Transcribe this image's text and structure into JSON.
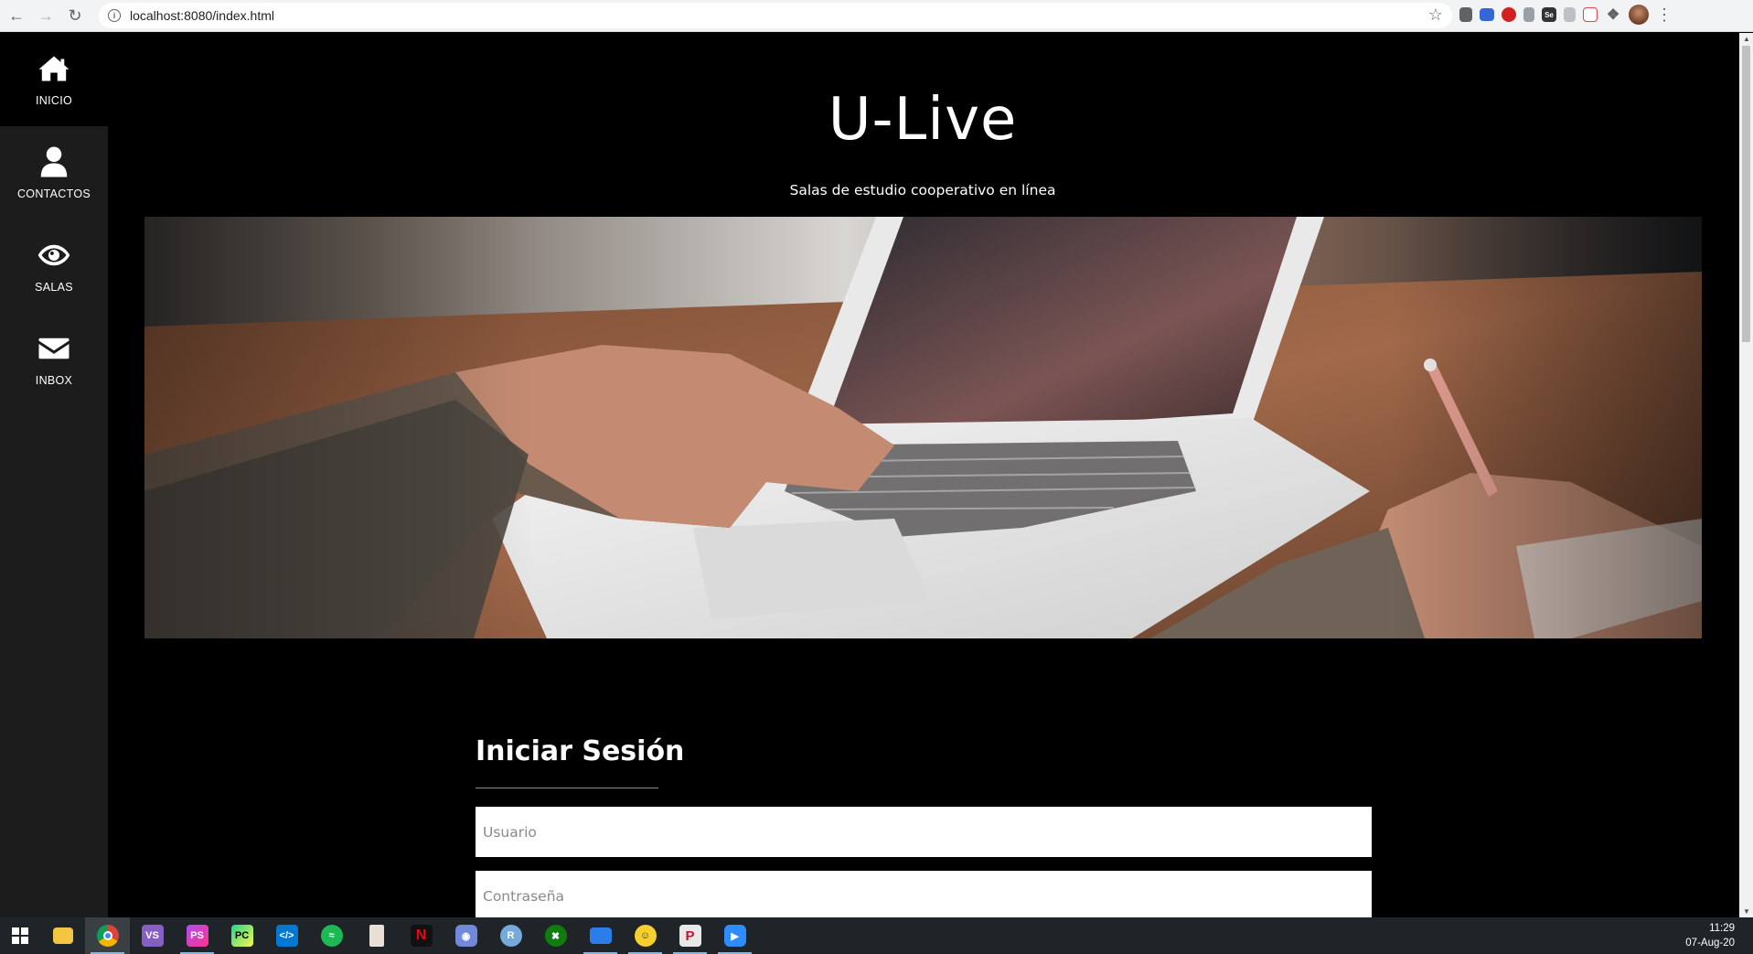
{
  "browser": {
    "url": "localhost:8080/index.html",
    "icons": [
      "back-arrow-icon",
      "forward-arrow-icon",
      "reload-icon",
      "site-info-icon",
      "bookmark-star-icon",
      "extensions-puzzle-icon",
      "profile-avatar",
      "menu-kebab-icon"
    ]
  },
  "sidebar": {
    "items": [
      {
        "label": "INICIO",
        "icon": "home-icon",
        "active": true
      },
      {
        "label": "CONTACTOS",
        "icon": "user-icon",
        "active": false
      },
      {
        "label": "SALAS",
        "icon": "eye-icon",
        "active": false
      },
      {
        "label": "INBOX",
        "icon": "envelope-icon",
        "active": false
      }
    ]
  },
  "header": {
    "title": "U-Live",
    "subtitle": "Salas de estudio cooperativo en línea"
  },
  "hero": {
    "description": "laptop-typing-photo"
  },
  "login": {
    "title": "Iniciar Sesión",
    "username_placeholder": "Usuario",
    "password_placeholder": "Contraseña"
  },
  "taskbar": {
    "time": "11:29",
    "date": "07-Aug-20",
    "apps": [
      "windows-start-icon",
      "file-explorer-icon",
      "chrome-icon",
      "visual-studio-icon",
      "phpstorm-icon",
      "pycharm-icon",
      "vscode-icon",
      "spotify-icon",
      "popcorn-icon",
      "netflix-icon",
      "discord-icon",
      "r-icon",
      "xbox-icon",
      "monitor-icon",
      "emoji-icon",
      "pinterest-icon",
      "zoom-icon"
    ]
  },
  "colors": {
    "page_bg": "#000000",
    "sidebar_bg": "#1c1c1c",
    "text": "#ffffff"
  }
}
